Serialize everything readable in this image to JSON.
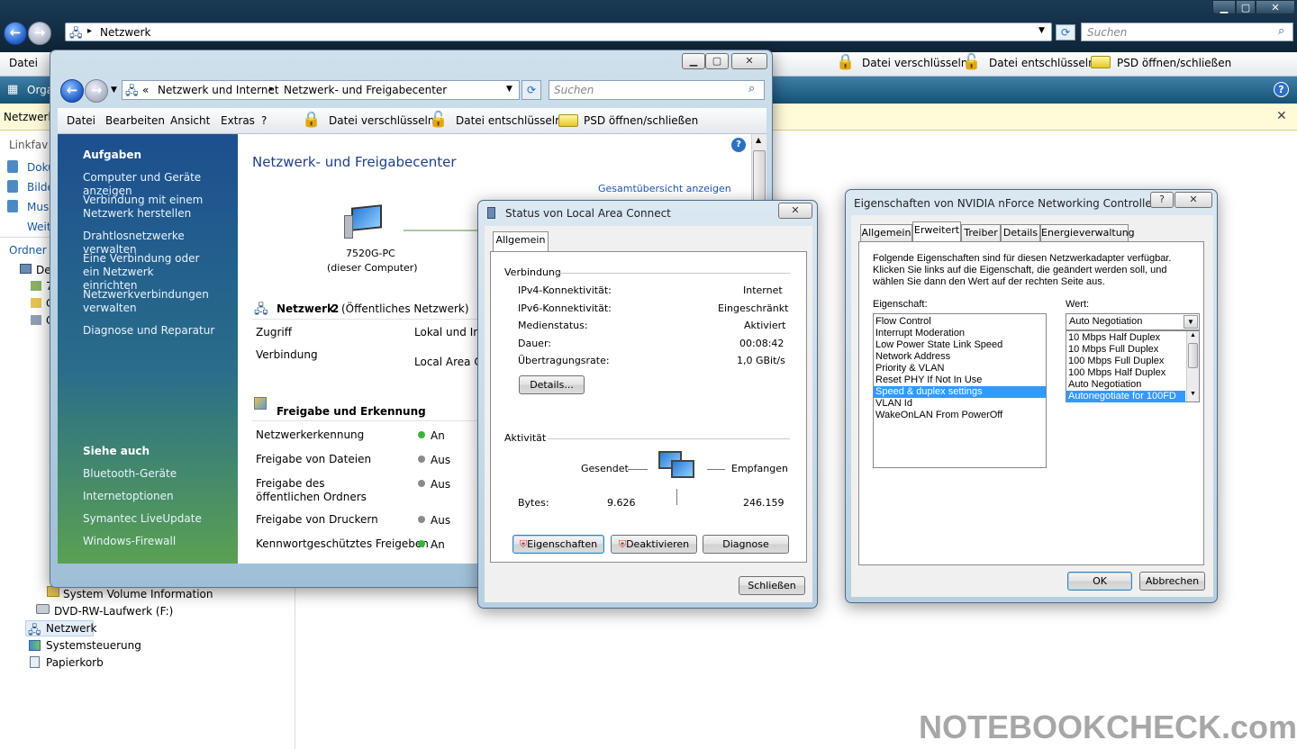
{
  "explorer": {
    "address": "Netzwerk",
    "search_placeholder": "Suchen",
    "menu": [
      "Datei"
    ],
    "toolbar_encrypt": "Datei verschlüsseln",
    "toolbar_decrypt": "Datei entschlüsseln",
    "toolbar_psd": "PSD öffnen/schließen",
    "organize": "Orga",
    "infobar": "Netzwerk",
    "linkfav": "Linkfav",
    "nav_fav": [
      "Doku",
      "Bilde",
      "Musi",
      "Weit"
    ],
    "ordner": "Ordner",
    "tree_partial": [
      "De",
      "7",
      "C",
      "C"
    ],
    "tree": [
      "System Volume Information",
      "DVD-RW-Laufwerk (F:)",
      "Netzwerk",
      "Systemsteuerung",
      "Papierkorb"
    ]
  },
  "nsc": {
    "breadcrumb_prefix": "«",
    "breadcrumb": [
      "Netzwerk und Internet",
      "Netzwerk- und Freigabecenter"
    ],
    "search_placeholder": "Suchen",
    "menu": [
      "Datei",
      "Bearbeiten",
      "Ansicht",
      "Extras",
      "?"
    ],
    "encrypt": "Datei verschlüsseln",
    "decrypt": "Datei entschlüsseln",
    "psd": "PSD öffnen/schließen",
    "tasks_heading": "Aufgaben",
    "tasks": [
      "Computer und Geräte anzeigen",
      "Verbindung mit einem Netzwerk herstellen",
      "Drahtlosnetzwerke verwalten",
      "Eine Verbindung oder ein Netzwerk einrichten",
      "Netzwerkverbindungen verwalten",
      "Diagnose und Reparatur"
    ],
    "see_also_heading": "Siehe auch",
    "see_also": [
      "Bluetooth-Geräte",
      "Internetoptionen",
      "Symantec LiveUpdate",
      "Windows-Firewall"
    ],
    "title": "Netzwerk- und Freigabecenter",
    "full_map": "Gesamtübersicht anzeigen",
    "computer_name": "7520G-PC",
    "computer_sub": "(dieser Computer)",
    "network_name": "Netzwerk",
    "network_num": "2",
    "network_type": "(Öffentliches Netzwerk)",
    "access_label": "Zugriff",
    "access_value": "Lokal und In",
    "connection_label": "Verbindung",
    "connection_value": "Local Area C",
    "sharing_heading": "Freigabe und Erkennung",
    "sharing": [
      {
        "label": "Netzwerkerkennung",
        "state": "An",
        "color": "#3cb43c"
      },
      {
        "label": "Freigabe von Dateien",
        "state": "Aus",
        "color": "#8a8a8a"
      },
      {
        "label": "Freigabe des öffentlichen Ordners",
        "state": "Aus",
        "color": "#8a8a8a"
      },
      {
        "label": "Freigabe von Druckern",
        "state": "Aus",
        "color": "#8a8a8a"
      },
      {
        "label": "Kennwortgeschütztes Freigeben",
        "state": "An",
        "color": "#3cb43c"
      }
    ]
  },
  "status": {
    "title": "Status von Local Area Connect",
    "tab": "Allgemein",
    "connection_heading": "Verbindung",
    "rows": [
      {
        "label": "IPv4-Konnektivität:",
        "value": "Internet"
      },
      {
        "label": "IPv6-Konnektivität:",
        "value": "Eingeschränkt"
      },
      {
        "label": "Medienstatus:",
        "value": "Aktiviert"
      },
      {
        "label": "Dauer:",
        "value": "00:08:42"
      },
      {
        "label": "Übertragungsrate:",
        "value": "1,0 GBit/s"
      }
    ],
    "details": "Details...",
    "activity_heading": "Aktivität",
    "sent": "Gesendet",
    "received": "Empfangen",
    "bytes_label": "Bytes:",
    "bytes_sent": "9.626",
    "bytes_received": "246.159",
    "btn_properties": "Eigenschaften",
    "btn_disable": "Deaktivieren",
    "btn_diagnose": "Diagnose",
    "btn_close": "Schließen"
  },
  "props": {
    "title": "Eigenschaften von NVIDIA nForce Networking Controller",
    "tabs": [
      "Allgemein",
      "Erweitert",
      "Treiber",
      "Details",
      "Energieverwaltung"
    ],
    "intro": "Folgende Eigenschaften sind für diesen Netzwerkadapter verfügbar. Klicken Sie links auf die Eigenschaft, die geändert werden soll, und wählen Sie dann den Wert auf der rechten Seite aus.",
    "property_label": "Eigenschaft:",
    "value_label": "Wert:",
    "properties": [
      "Flow Control",
      "Interrupt Moderation",
      "Low Power State Link Speed",
      "Network Address",
      "Priority & VLAN",
      "Reset PHY If Not In Use",
      "Speed & duplex settings",
      "VLAN Id",
      "WakeOnLAN From PowerOff"
    ],
    "selected_property": 6,
    "value_selected": "Auto Negotiation",
    "values": [
      "10 Mbps Half Duplex",
      "10 Mbps Full Duplex",
      "100 Mbps Full Duplex",
      "100 Mbps Half Duplex",
      "Auto Negotiation",
      "Autonegotiate for 100FD"
    ],
    "selected_value": 5,
    "ok": "OK",
    "cancel": "Abbrechen"
  },
  "watermark": "NOTEBOOKCHECK.com"
}
